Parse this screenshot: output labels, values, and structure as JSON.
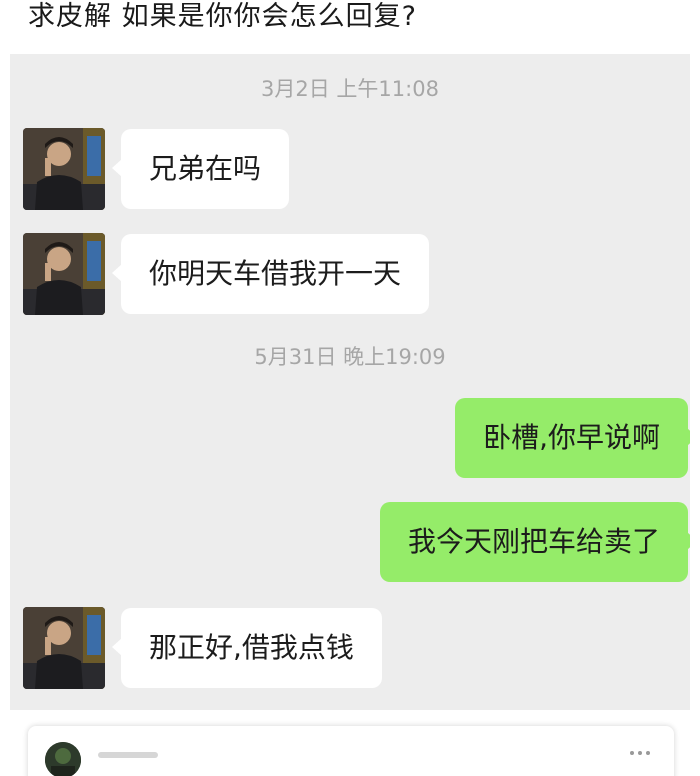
{
  "post": {
    "title": "求皮解 如果是你你会怎么回复?"
  },
  "chat": {
    "timestamps": [
      "3月2日 上午11:08",
      "5月31日 晚上19:09"
    ],
    "messages": [
      {
        "direction": "incoming",
        "text": "兄弟在吗"
      },
      {
        "direction": "incoming",
        "text": "你明天车借我开一天"
      },
      {
        "direction": "outgoing",
        "text": "卧槽,你早说啊"
      },
      {
        "direction": "outgoing",
        "text": "我今天刚把车给卖了"
      },
      {
        "direction": "incoming",
        "text": "那正好,借我点钱"
      }
    ]
  },
  "colors": {
    "chat_background": "#ededed",
    "incoming_bubble": "#ffffff",
    "outgoing_bubble": "#95ec69",
    "timestamp_text": "#a6a6a6"
  }
}
